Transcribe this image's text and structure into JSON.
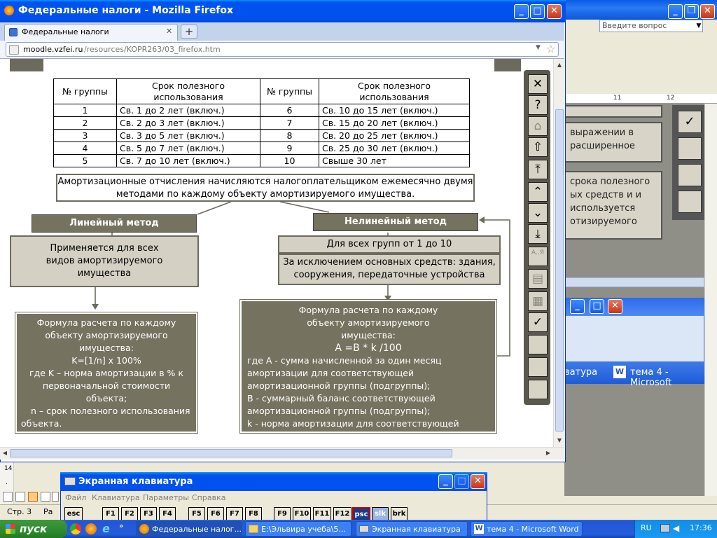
{
  "word": {
    "search_placeholder": "Введите вопрос",
    "ruler_marks": [
      "11",
      "12"
    ],
    "boxes": [
      "выражении в расширенное",
      "срока полезного ых средств и и используется отизируемого"
    ],
    "task_tile": "тема 4 - Microsoft",
    "task_tile_left": "ватура",
    "status_page": "Стр. 3",
    "status_section": "Ра",
    "side_nums": [
      "14",
      "."
    ]
  },
  "firefox": {
    "window_title": "Федеральные налоги - Mozilla Firefox",
    "tab_label": "Федеральные налоги",
    "url_host": "moodle.vzfei.ru",
    "url_path": "/resources/KOPR263/03_firefox.htm"
  },
  "page": {
    "table": {
      "headers": [
        "№ группы",
        "Срок полезного использования",
        "№ группы",
        "Срок полезного использования"
      ],
      "rows": [
        [
          "1",
          "Св. 1 до 2 лет (включ.)",
          "6",
          "Св. 10 до 15 лет (включ.)"
        ],
        [
          "2",
          "Св. 2 до 3 лет (включ.)",
          "7",
          "Св. 15 до 20 лет (включ.)"
        ],
        [
          "3",
          "Св. 3 до 5 лет (включ.)",
          "8",
          "Св. 20 до 25 лет (включ.)"
        ],
        [
          "4",
          "Св. 5 до 7 лет (включ.)",
          "9",
          "Св. 25 до 30 лет (включ.)"
        ],
        [
          "5",
          "Св. 7 до 10 лет (включ.)",
          "10",
          "Свыше 30 лет"
        ]
      ]
    },
    "amortization_note": "Амортизационные отчисления начисляются налогоплательщиком ежемесячно двумя методами по каждому объекту амортизируемого имущества.",
    "linear_title": "Линейный метод",
    "nonlinear_title": "Нелинейный метод",
    "linear_applies": "Применяется для всех видов амортизируемого имущества",
    "nonlinear_groups": "Для всех групп от 1 до 10",
    "nonlinear_except": "За исключением основных средств: здания, сооружения, передаточные устройства",
    "linear_formula": {
      "line1": "Формула расчета по каждому объекту амортизируемого имущества:",
      "formula": "K=[1/n] x 100%",
      "line2": "где K – норма амортизации в % к первоначальной стоимости объекта;",
      "line3": "n – срок полезного использования объекта."
    },
    "nonlinear_formula": {
      "line1": "Формула расчета по каждому объекту амортизируемого имущества:",
      "formula": "A =B * k /100",
      "line2": "где A - сумма начисленной за один месяц амортизации для соответствующей амортизационной группы (подгруппы);",
      "line3": "B - суммарный баланс соответствующей амортизационной группы (подгруппы);",
      "line4": "k - норма амортизации для соответствующей амортизационной группы (подгруппы)."
    }
  },
  "side_nav": {
    "close": "✕",
    "help": "?",
    "home": "⌂",
    "up": "⇧",
    "top": "⤒",
    "prev": "⌃",
    "next": "⌄",
    "bottom": "⤓",
    "glossary": "А..Я",
    "doc": "▤",
    "calc": "▦",
    "check": "✓"
  },
  "osk": {
    "title": "Экранная клавиатура",
    "menu": [
      "Файл",
      "Клавиатура",
      "Параметры",
      "Справка"
    ],
    "keys": [
      "esc",
      "F1",
      "F2",
      "F3",
      "F4",
      "F5",
      "F6",
      "F7",
      "F8",
      "F9",
      "F10",
      "F11",
      "F12",
      "psc",
      "slk",
      "brk"
    ]
  },
  "taskbar": {
    "start": "пуск",
    "tasks": [
      "Федеральные налог...",
      "E:\\Эльвира учеба\\5...",
      "Экранная клавиатура",
      "тема 4 - Microsoft Word"
    ],
    "lang": "RU",
    "time": "17:36"
  },
  "colors": {
    "dark_box": "#75725f",
    "light_box": "#d4d1c4",
    "xp_blue": "#0053ee"
  }
}
